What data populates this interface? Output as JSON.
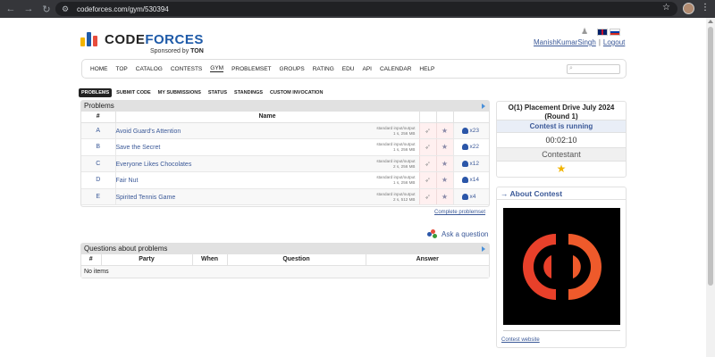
{
  "browser": {
    "url": "codeforces.com/gym/530394"
  },
  "header": {
    "logo_code": "CODE",
    "logo_forces": "FORCES",
    "sponsor_prefix": "Sponsored by ",
    "sponsor_name": "TON",
    "user": "ManishKumarSingh",
    "separator": "|",
    "logout": "Logout"
  },
  "menu": [
    "HOME",
    "TOP",
    "CATALOG",
    "CONTESTS",
    "GYM",
    "PROBLEMSET",
    "GROUPS",
    "RATING",
    "EDU",
    "API",
    "CALENDAR",
    "HELP"
  ],
  "menu_active": "GYM",
  "submenu": [
    "PROBLEMS",
    "SUBMIT CODE",
    "MY SUBMISSIONS",
    "STATUS",
    "STANDINGS",
    "CUSTOM INVOCATION"
  ],
  "submenu_active": "PROBLEMS",
  "problems": {
    "caption": "Problems",
    "col_index": "#",
    "col_name": "Name",
    "rows": [
      {
        "index": "A",
        "name": "Avoid Guard's Attention",
        "io": "standard input/output",
        "limits": "1 s, 256 MB",
        "solved": "x23"
      },
      {
        "index": "B",
        "name": "Save the Secret",
        "io": "standard input/output",
        "limits": "1 s, 256 MB",
        "solved": "x22"
      },
      {
        "index": "C",
        "name": "Everyone Likes Chocolates",
        "io": "standard input/output",
        "limits": "2 s, 256 MB",
        "solved": "x12"
      },
      {
        "index": "D",
        "name": "Fair Nut",
        "io": "standard input/output",
        "limits": "1 s, 256 MB",
        "solved": "x14"
      },
      {
        "index": "E",
        "name": "Spirited Tennis Game",
        "io": "standard input/output",
        "limits": "2 s, 512 MB",
        "solved": "x4"
      }
    ],
    "complete_link": "Complete problemset",
    "ask_question": "Ask a question"
  },
  "questions": {
    "caption": "Questions about problems",
    "columns": [
      "#",
      "Party",
      "When",
      "Question",
      "Answer"
    ],
    "empty": "No items"
  },
  "contest": {
    "title": "O(1) Placement Drive July 2024 (Round 1)",
    "state": "Contest is running",
    "timer": "00:02:10",
    "role": "Contestant"
  },
  "about": {
    "caption": "→ About Contest",
    "link": "Contest website"
  },
  "colors": {
    "accent_blue": "#3b5998",
    "logo_blue": "#1e5aa8",
    "logo_red": "#e74c3c",
    "logo_yellow": "#f2b400",
    "star_gold": "#f2b400"
  },
  "icons": {
    "back": "back-arrow-icon",
    "forward": "forward-arrow-icon",
    "reload": "reload-icon",
    "bookmark": "star-icon",
    "submit": "paper-plane-icon",
    "favorite": "star-icon",
    "solvers": "person-icon"
  }
}
